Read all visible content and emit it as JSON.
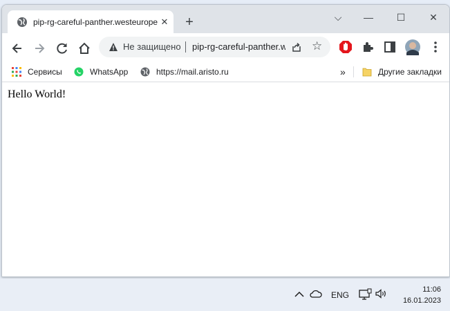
{
  "tab": {
    "title": "pip-rg-careful-panther.westeurope",
    "close": "✕",
    "new_tab": "+"
  },
  "window_controls": {
    "dropdown": "⌵",
    "minimize": "—",
    "maximize": "☐",
    "close": "✕"
  },
  "omnibox": {
    "security_label": "Не защищено",
    "url": "pip-rg-careful-panther.westeurope"
  },
  "bookmarks": {
    "items": [
      {
        "label": "Сервисы"
      },
      {
        "label": "WhatsApp"
      },
      {
        "label": "https://mail.aristo.ru"
      }
    ],
    "overflow": "»",
    "other_folder": "Другие закладки"
  },
  "page": {
    "text": "Hello World!"
  },
  "taskbar": {
    "language": "ENG",
    "time": "11:06",
    "date": "16.01.2023"
  },
  "colors": {
    "tab_strip": "#dfe3e8",
    "omnibox": "#f1f3f4",
    "taskbar": "#e9eef6",
    "whatsapp": "#25d366",
    "adblock": "#e4161c"
  }
}
